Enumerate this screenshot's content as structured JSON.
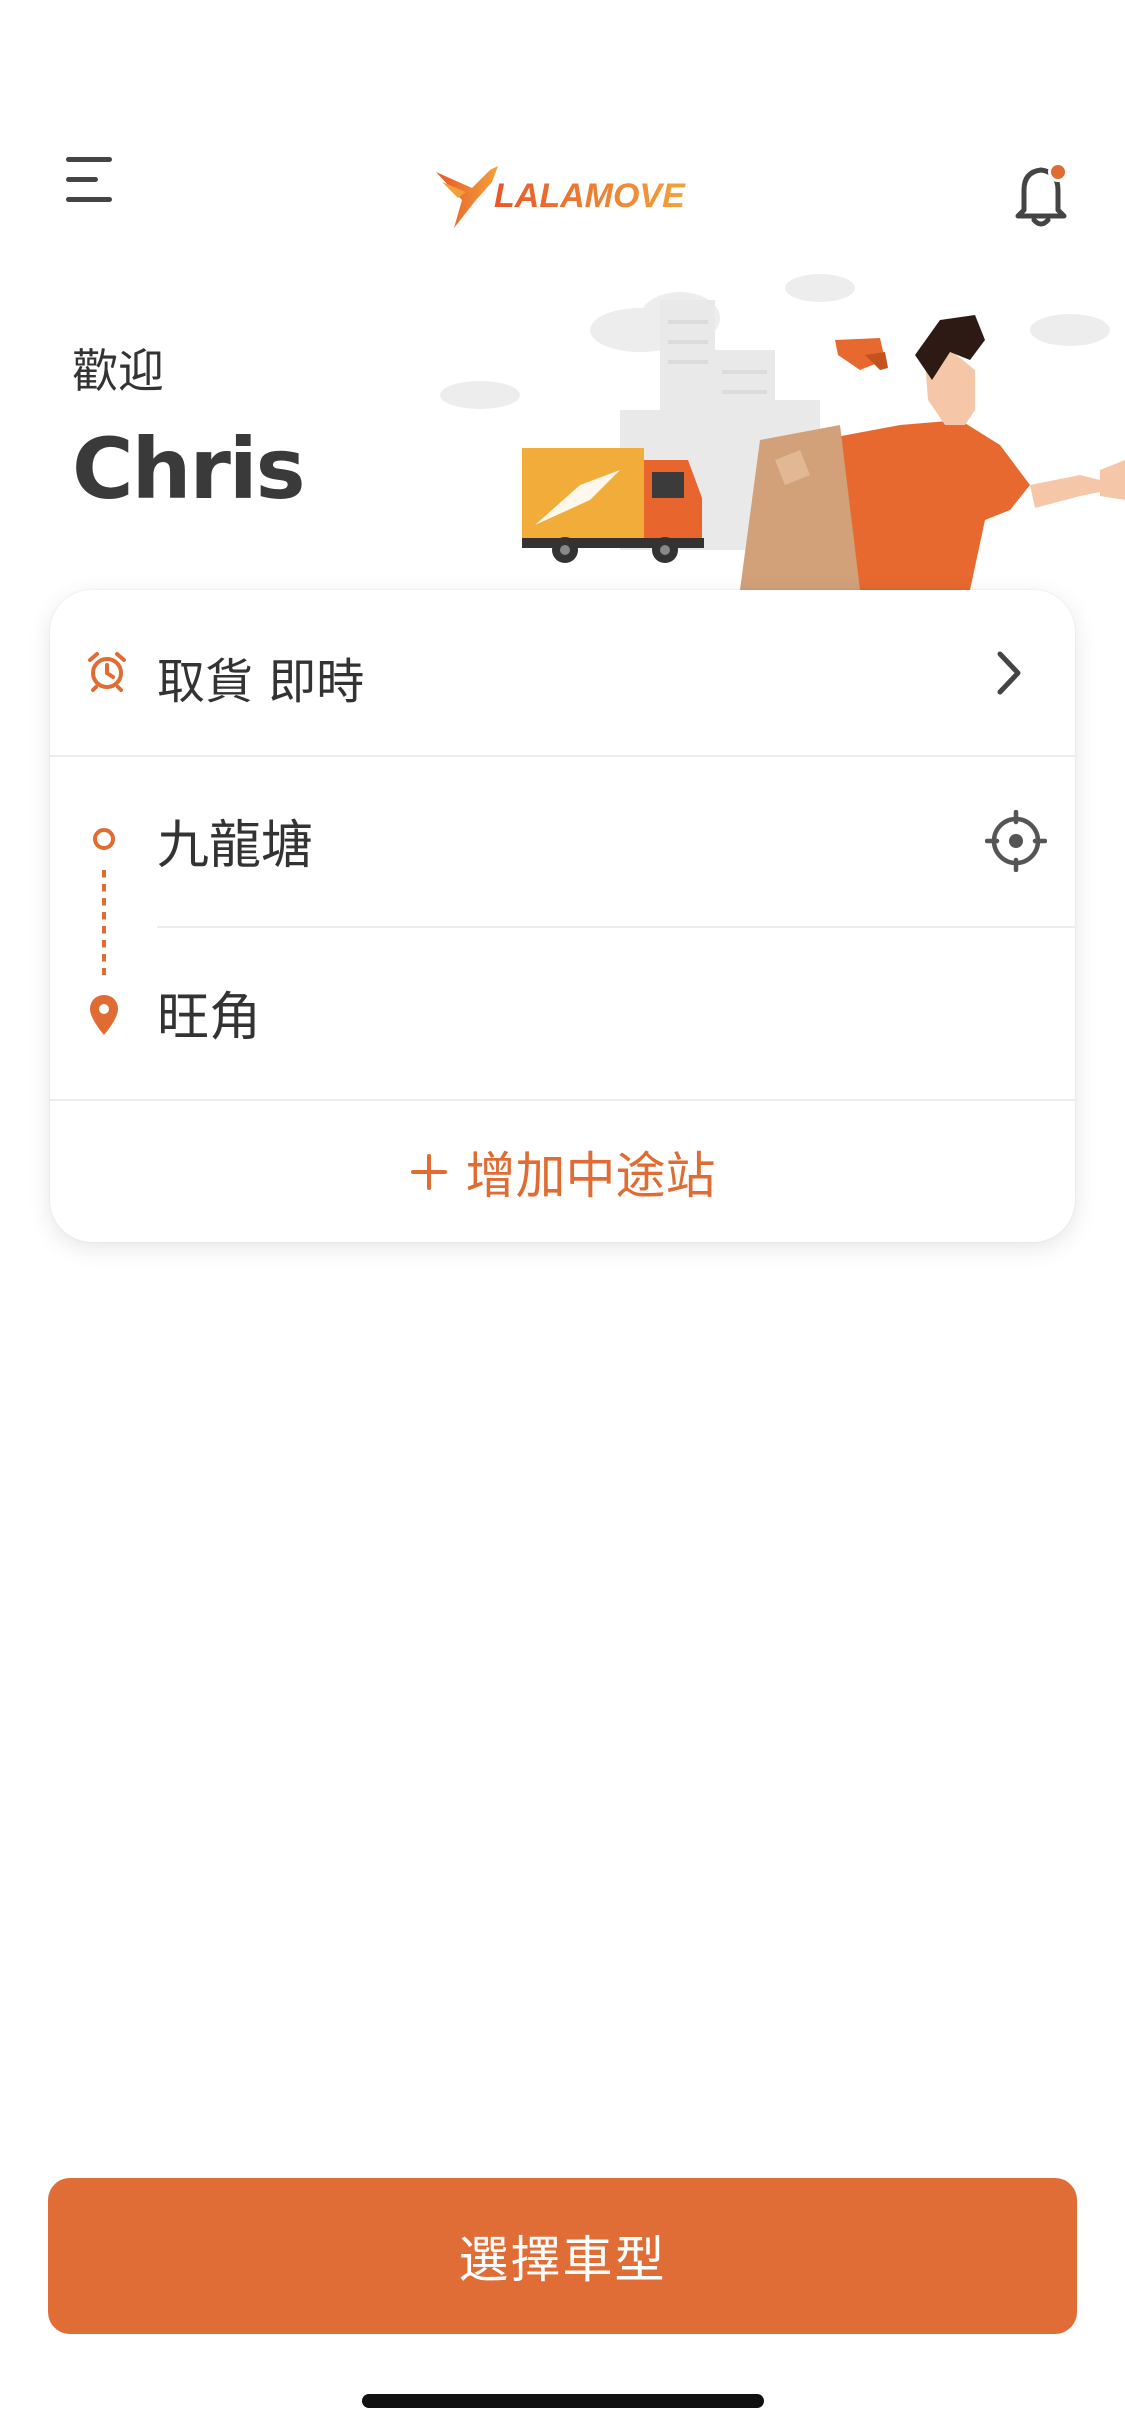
{
  "header": {
    "logo_text": "LALAMOVE",
    "notification_badge": true
  },
  "welcome": {
    "label": "歡迎",
    "name": "Chris"
  },
  "route": {
    "pickup_time": "取貨 即時",
    "origin": "九龍塘",
    "destination": "旺角",
    "add_stop_label": "增加中途站"
  },
  "actions": {
    "select_vehicle_label": "選擇車型"
  },
  "icons": {
    "menu": "menu-icon",
    "bell": "bell-icon",
    "alarm": "alarm-clock-icon",
    "chevron": "chevron-right-icon",
    "locate": "crosshair-icon",
    "pin": "map-pin-icon",
    "plus": "plus-icon"
  },
  "colors": {
    "accent": "#e06c36",
    "logo_gradient_start": "#e8572a",
    "logo_gradient_end": "#f2a23a",
    "text": "#333333",
    "divider": "#ececec"
  }
}
